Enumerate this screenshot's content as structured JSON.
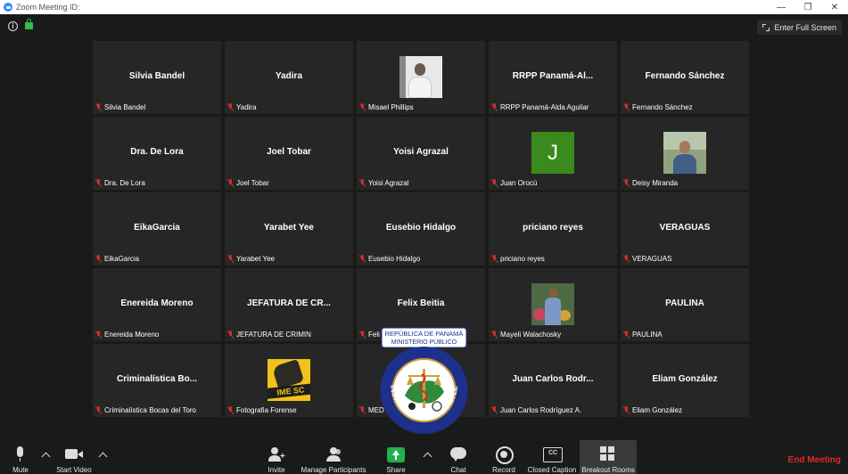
{
  "window": {
    "title": "Zoom Meeting ID:"
  },
  "topbar": {
    "fullscreen_label": "Enter Full Screen"
  },
  "tiles": [
    {
      "display": "Silvia Bandel",
      "label": "Silvia Bandel"
    },
    {
      "display": "Yadira",
      "label": "Yadira"
    },
    {
      "display": "",
      "label": "Misael Phillips",
      "photo": "misael"
    },
    {
      "display": "RRPP  Panamá-Al...",
      "label": "RRPP Panamá-Alda Aguilar"
    },
    {
      "display": "Fernando Sánchez",
      "label": "Fernando Sánchez"
    },
    {
      "display": "Dra. De Lora",
      "label": "Dra. De Lora"
    },
    {
      "display": "Joel Tobar",
      "label": "Joel Tobar"
    },
    {
      "display": "Yoisi Agrazal",
      "label": "Yoisi Agrazal"
    },
    {
      "display": "",
      "label": "Juan Orocú",
      "letter": "J"
    },
    {
      "display": "",
      "label": "Deisy Miranda",
      "photo": "deisy"
    },
    {
      "display": "EikaGarcia",
      "label": "EikaGarcia"
    },
    {
      "display": "Yarabet Yee",
      "label": "Yarabet Yee"
    },
    {
      "display": "Eusebio Hidalgo",
      "label": "Eusebio Hidalgo"
    },
    {
      "display": "priciano reyes",
      "label": "priciano reyes"
    },
    {
      "display": "VERAGUAS",
      "label": "VERAGUAS"
    },
    {
      "display": "Enereida Moreno",
      "label": "Enereida Moreno"
    },
    {
      "display": "JEFATURA  DE  CR...",
      "label": "JEFATURA DE CRIMIN"
    },
    {
      "display": "Felix Beitia",
      "label": "Feli"
    },
    {
      "display": "",
      "label": "Mayeli Walachosky",
      "photo": "mayeli"
    },
    {
      "display": "PAULINA",
      "label": "PAULINA"
    },
    {
      "display": "Criminalística  Bo...",
      "label": "Criminalística Bocas del Toro"
    },
    {
      "display": "",
      "label": "Fotografia Forense",
      "photo": "forense",
      "photo_text": "IME SC"
    },
    {
      "display": "",
      "label": "MED"
    },
    {
      "display": "Juan Carlos  Rodr...",
      "label": "Juan Carlos Rodríguez A."
    },
    {
      "display": "Eliam González",
      "label": "Eliam González"
    }
  ],
  "logo": {
    "line1": "REPÚBLICA DE PANAMÁ",
    "line2": "MINISTERIO PÚBLICO",
    "ring_text": "INSTITUTO DE MEDICINA LEGAL Y CIENCIAS FORENSES"
  },
  "toolbar": {
    "mute": "Mute",
    "start_video": "Start Video",
    "invite": "Invite",
    "manage_participants": "Manage Participants",
    "share": "Share",
    "chat": "Chat",
    "record": "Record",
    "closed_caption": "Closed Caption",
    "breakout_rooms": "Breakout Rooms",
    "end_meeting": "End Meeting"
  },
  "colors": {
    "mic_off": "#d32b2b",
    "share": "#1fb14c",
    "end_meeting": "#e02828",
    "letter_avatar": "#3b8a1e"
  }
}
